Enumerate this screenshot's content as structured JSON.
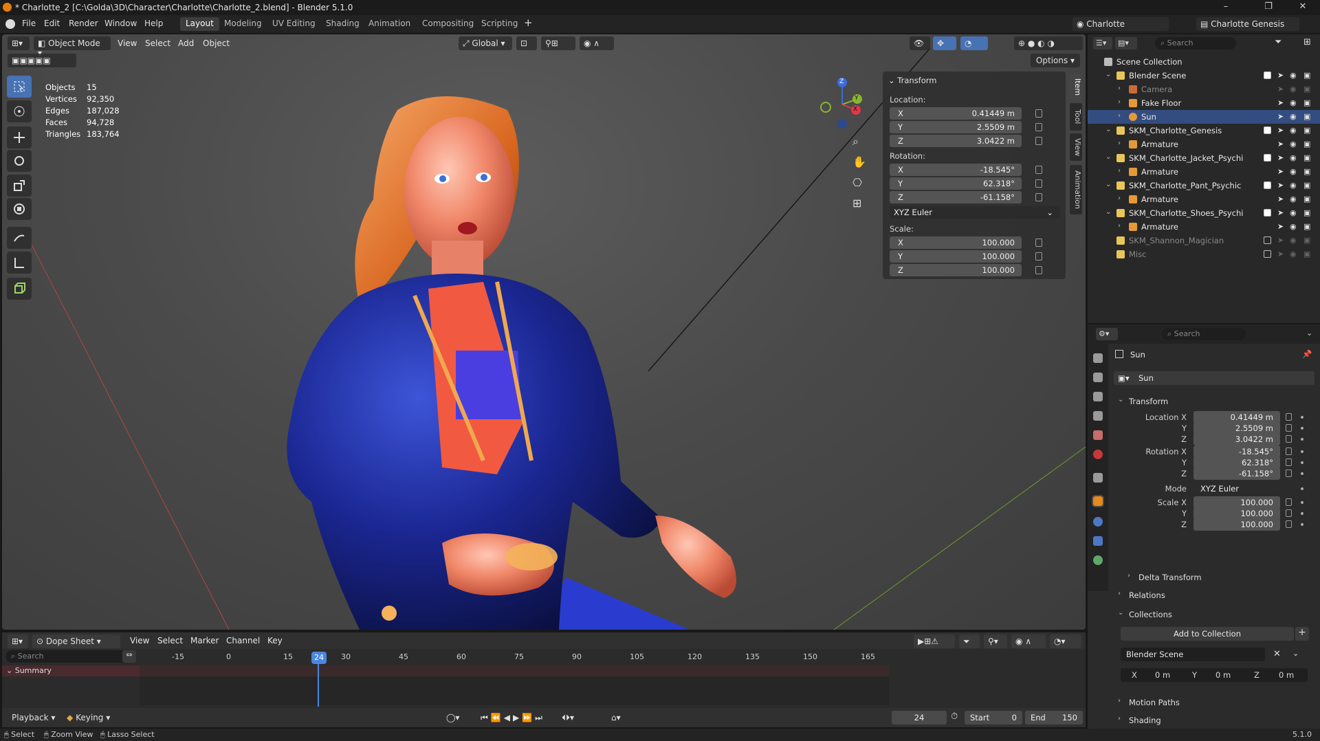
{
  "window": {
    "title": "* Charlotte_2 [C:\\Golda\\3D\\Character\\Charlotte\\Charlotte_2.blend] - Blender 5.1.0",
    "min": "–",
    "max": "❐",
    "close": "✕"
  },
  "menu": [
    "File",
    "Edit",
    "Render",
    "Window",
    "Help"
  ],
  "workspaces": [
    "Layout",
    "Modeling",
    "UV Editing",
    "Shading",
    "Animation",
    "Compositing",
    "Scripting"
  ],
  "scene": {
    "name": "Charlotte",
    "view_layer": "Charlotte Genesis"
  },
  "viewport": {
    "mode": "Object Mode",
    "menus": [
      "View",
      "Select",
      "Add",
      "Object"
    ],
    "orientation": "Global",
    "options_label": "Options",
    "stats": [
      {
        "label": "Objects",
        "value": "15"
      },
      {
        "label": "Vertices",
        "value": "92,350"
      },
      {
        "label": "Edges",
        "value": "187,028"
      },
      {
        "label": "Faces",
        "value": "94,728"
      },
      {
        "label": "Triangles",
        "value": "183,764"
      }
    ],
    "gizmo": {
      "z": "Z",
      "y": "Y",
      "x": "X"
    }
  },
  "npanel": {
    "header": "Transform",
    "location_label": "Location:",
    "location": [
      {
        "axis": "X",
        "value": "0.41449 m"
      },
      {
        "axis": "Y",
        "value": "2.5509 m"
      },
      {
        "axis": "Z",
        "value": "3.0422 m"
      }
    ],
    "rotation_label": "Rotation:",
    "rotation": [
      {
        "axis": "X",
        "value": "-18.545°"
      },
      {
        "axis": "Y",
        "value": "62.318°"
      },
      {
        "axis": "Z",
        "value": "-61.158°"
      }
    ],
    "rotation_mode": "XYZ Euler",
    "scale_label": "Scale:",
    "scale": [
      {
        "axis": "X",
        "value": "100.000"
      },
      {
        "axis": "Y",
        "value": "100.000"
      },
      {
        "axis": "Z",
        "value": "100.000"
      }
    ],
    "tabs": [
      "Item",
      "Tool",
      "View",
      "Animation"
    ]
  },
  "outliner": {
    "search_placeholder": "Search",
    "rows": [
      {
        "name": "Scene Collection",
        "indent": 0,
        "icon": "scene-collection-icon",
        "chev": "",
        "dim": false,
        "sel": false,
        "chk": "none"
      },
      {
        "name": "Blender Scene",
        "indent": 1,
        "icon": "collection-icon",
        "chev": "⌄",
        "dim": false,
        "sel": false,
        "chk": "on"
      },
      {
        "name": "Camera",
        "indent": 2,
        "icon": "camera-icon",
        "chev": "›",
        "dim": true,
        "sel": false,
        "chk": "none"
      },
      {
        "name": "Fake Floor",
        "indent": 2,
        "icon": "mesh-icon",
        "chev": "›",
        "dim": false,
        "sel": false,
        "chk": "none"
      },
      {
        "name": "Sun",
        "indent": 2,
        "icon": "light-icon",
        "chev": "›",
        "dim": false,
        "sel": true,
        "chk": "none"
      },
      {
        "name": "SKM_Charlotte_Genesis",
        "indent": 1,
        "icon": "collection-icon",
        "chev": "⌄",
        "dim": false,
        "sel": false,
        "chk": "on"
      },
      {
        "name": "Armature",
        "indent": 2,
        "icon": "armature-icon",
        "chev": "›",
        "dim": false,
        "sel": false,
        "chk": "none"
      },
      {
        "name": "SKM_Charlotte_Jacket_Psychi",
        "indent": 1,
        "icon": "collection-icon",
        "chev": "⌄",
        "dim": false,
        "sel": false,
        "chk": "on"
      },
      {
        "name": "Armature",
        "indent": 2,
        "icon": "armature-icon",
        "chev": "›",
        "dim": false,
        "sel": false,
        "chk": "none"
      },
      {
        "name": "SKM_Charlotte_Pant_Psychic",
        "indent": 1,
        "icon": "collection-icon",
        "chev": "⌄",
        "dim": false,
        "sel": false,
        "chk": "on"
      },
      {
        "name": "Armature",
        "indent": 2,
        "icon": "armature-icon",
        "chev": "›",
        "dim": false,
        "sel": false,
        "chk": "none"
      },
      {
        "name": "SKM_Charlotte_Shoes_Psychi",
        "indent": 1,
        "icon": "collection-icon",
        "chev": "⌄",
        "dim": false,
        "sel": false,
        "chk": "on"
      },
      {
        "name": "Armature",
        "indent": 2,
        "icon": "armature-icon",
        "chev": "›",
        "dim": false,
        "sel": false,
        "chk": "none"
      },
      {
        "name": "SKM_Shannon_Magician",
        "indent": 1,
        "icon": "collection-icon",
        "chev": "",
        "dim": true,
        "sel": false,
        "chk": "off"
      },
      {
        "name": "Misc",
        "indent": 1,
        "icon": "collection-icon",
        "chev": "",
        "dim": true,
        "sel": false,
        "chk": "off"
      }
    ]
  },
  "properties": {
    "search_placeholder": "Search",
    "object_name": "Sun",
    "data_name": "Sun",
    "transform_header": "Transform",
    "fields": [
      {
        "label": "Location X",
        "value": "0.41449 m",
        "lock": true
      },
      {
        "label": "Y",
        "value": "2.5509 m",
        "lock": true
      },
      {
        "label": "Z",
        "value": "3.0422 m",
        "lock": true
      },
      {
        "label": "Rotation X",
        "value": "-18.545°",
        "lock": true
      },
      {
        "label": "Y",
        "value": "62.318°",
        "lock": true
      },
      {
        "label": "Z",
        "value": "-61.158°",
        "lock": true
      },
      {
        "label": "Mode",
        "value": "XYZ Euler",
        "lock": false
      },
      {
        "label": "Scale X",
        "value": "100.000",
        "lock": true
      },
      {
        "label": "Y",
        "value": "100.000",
        "lock": true
      },
      {
        "label": "Z",
        "value": "100.000",
        "lock": true
      }
    ],
    "delta_transform": "Delta Transform",
    "relations": "Relations",
    "collections": "Collections",
    "add_to_collection": "Add to Collection",
    "collection_name": "Blender Scene",
    "offset": [
      {
        "axis": "X",
        "value": "0 m"
      },
      {
        "axis": "Y",
        "value": "0 m"
      },
      {
        "axis": "Z",
        "value": "0 m"
      }
    ],
    "motion_paths": "Motion Paths",
    "shading": "Shading"
  },
  "dopesheet": {
    "mode": "Dope Sheet",
    "menus": [
      "View",
      "Select",
      "Marker",
      "Channel",
      "Key"
    ],
    "search_placeholder": "Search",
    "summary": "Summary",
    "ticks": [
      "-15",
      "0",
      "15",
      "24",
      "30",
      "45",
      "60",
      "75",
      "90",
      "105",
      "120",
      "135",
      "150",
      "165"
    ],
    "current_frame": "24",
    "playback": "Playback",
    "keying": "Keying",
    "frame_display": "24",
    "start_label": "Start",
    "start_value": "0",
    "end_label": "End",
    "end_value": "150"
  },
  "status": {
    "select": "Select",
    "zoom": "Zoom View",
    "lasso": "Lasso Select",
    "version": "5.1.0"
  }
}
